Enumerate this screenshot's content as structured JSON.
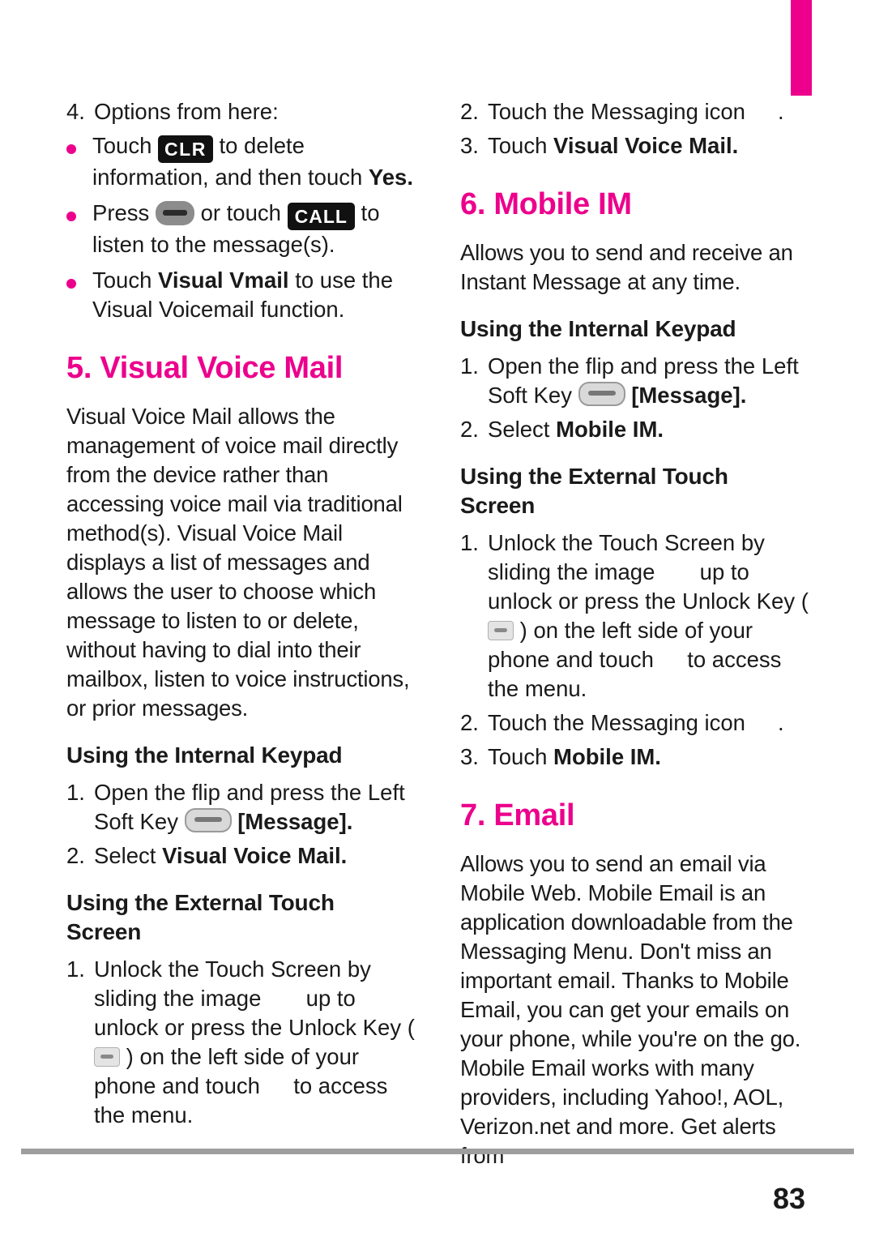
{
  "page": {
    "number": "83"
  },
  "left_column": {
    "item4": {
      "num": "4.",
      "text": "Options from here:"
    },
    "bullets": [
      {
        "pre": "Touch ",
        "key": "CLR",
        "post": " to delete information, and then touch ",
        "bold_tail": "Yes."
      },
      {
        "pre": "Press ",
        "mid": " or touch ",
        "key": "CALL",
        "post": " to listen to the message(s)."
      },
      {
        "pre": "Touch ",
        "bold": "Visual Vmail",
        "post": " to use the Visual Voicemail function."
      }
    ],
    "section5": {
      "heading": "5. Visual Voice Mail",
      "paragraph": "Visual Voice Mail allows the management of voice mail directly from the device rather than accessing voice mail via traditional method(s). Visual Voice Mail displays a list of messages and allows the user to choose which message to listen to or delete, without having to dial into their mailbox, listen to voice instructions, or prior messages.",
      "sub1": "Using the Internal Keypad",
      "steps1": [
        {
          "num": "1.",
          "pre": "Open the flip and press the Left Soft Key ",
          "post": " [Message]."
        },
        {
          "num": "2.",
          "pre": "Select ",
          "bold": "Visual Voice Mail."
        }
      ],
      "sub2": "Using the External Touch Screen",
      "steps2": [
        {
          "num": "1.",
          "a": "Unlock the Touch Screen by sliding the image ",
          "b": " up to unlock or press the Unlock Key ( ",
          "c": " ) on the left side of your phone and touch ",
          "d": " to access the menu."
        }
      ]
    }
  },
  "right_column": {
    "top_steps": [
      {
        "num": "2.",
        "text": "Touch the Messaging icon",
        "tail": "."
      },
      {
        "num": "3.",
        "pre": "Touch ",
        "bold": "Visual Voice Mail."
      }
    ],
    "section6": {
      "heading": "6. Mobile IM",
      "paragraph": "Allows you to send and receive an Instant Message at any time.",
      "sub1": "Using the Internal Keypad",
      "steps1": [
        {
          "num": "1.",
          "pre": "Open the flip and press the Left Soft Key ",
          "post": " [Message]."
        },
        {
          "num": "2.",
          "pre": "Select ",
          "bold": "Mobile IM."
        }
      ],
      "sub2": "Using the External Touch Screen",
      "steps2": [
        {
          "num": "1.",
          "a": "Unlock the Touch Screen by sliding the image ",
          "b": " up to unlock or press the Unlock Key ( ",
          "c": " ) on the left side of your phone and touch ",
          "d": " to access the menu."
        },
        {
          "num": "2.",
          "text": "Touch the Messaging icon",
          "tail": "."
        },
        {
          "num": "3.",
          "pre": "Touch ",
          "bold": "Mobile IM."
        }
      ]
    },
    "section7": {
      "heading": "7. Email",
      "paragraph": "Allows you to send an email via Mobile Web. Mobile Email is an application downloadable from the Messaging Menu. Don't miss an important email. Thanks to Mobile Email, you can get your emails on your phone, while you're on the go. Mobile Email works with many providers, including Yahoo!, AOL, Verizon.net and more. Get alerts from"
    }
  },
  "colors": {
    "accent": "#ec008c",
    "text": "#1a1a1a",
    "rule": "#9e9e9e"
  }
}
